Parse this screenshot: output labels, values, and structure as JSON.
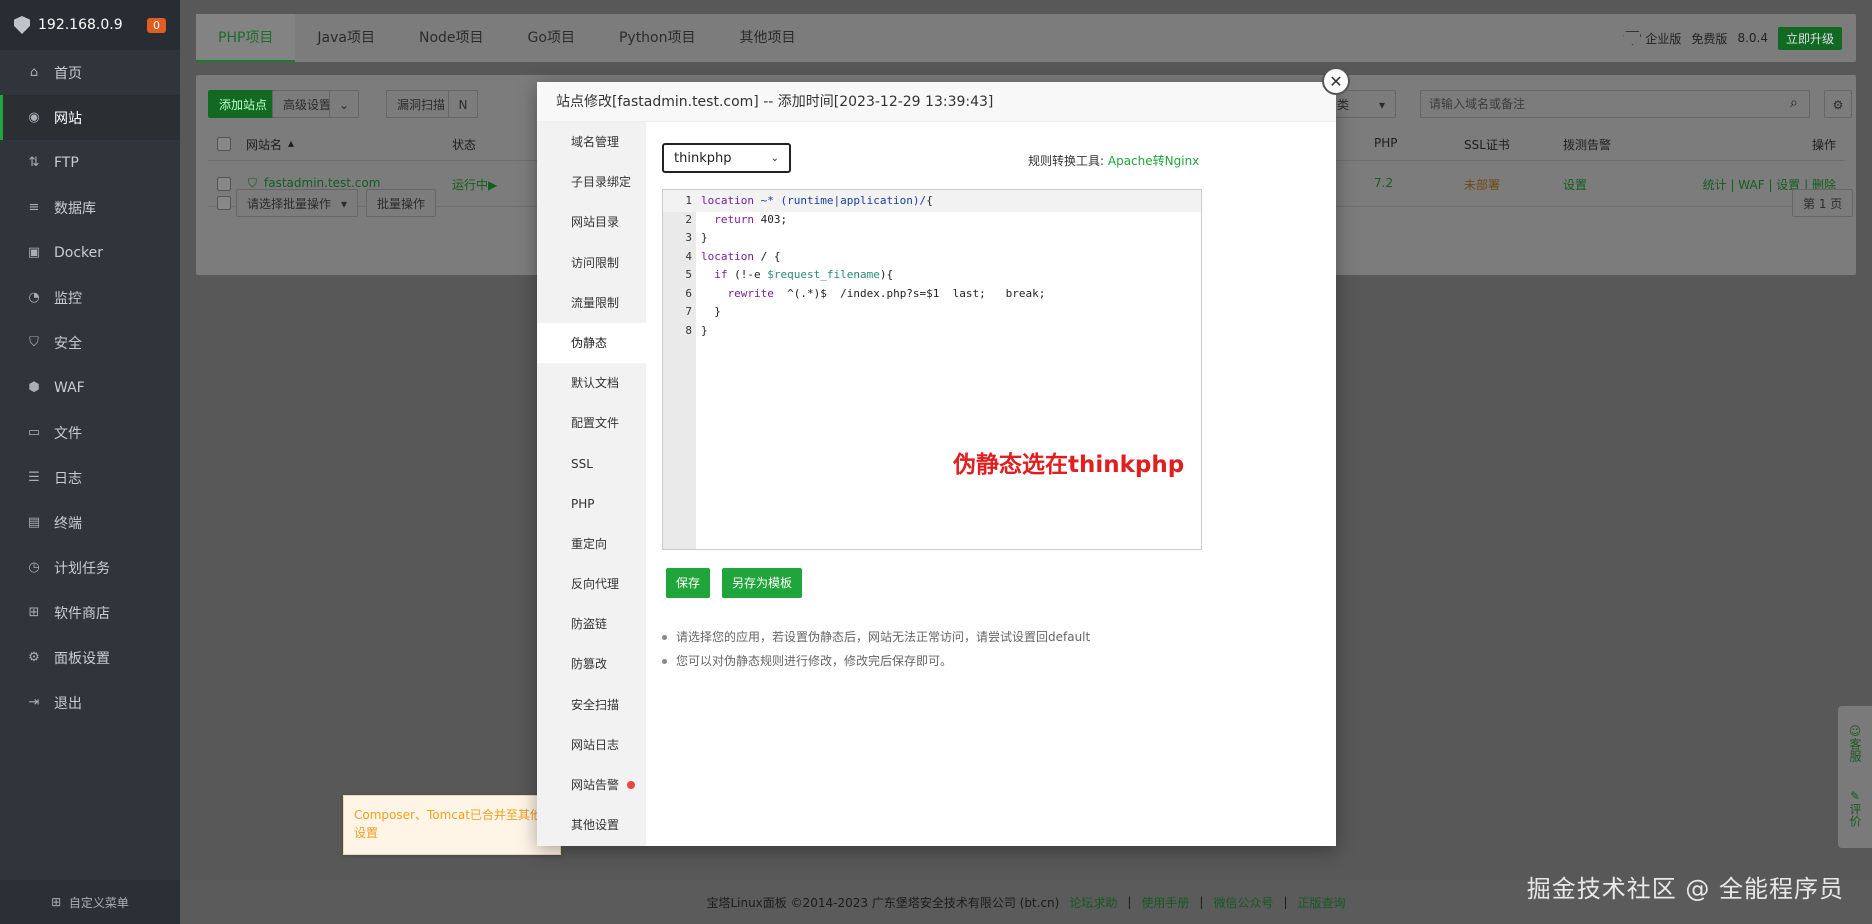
{
  "sidebar": {
    "ip": "192.168.0.9",
    "badge": "0",
    "items": [
      {
        "label": "首页",
        "icon": "home-icon",
        "glyph": "⌂"
      },
      {
        "label": "网站",
        "icon": "globe-icon",
        "glyph": "◉"
      },
      {
        "label": "FTP",
        "icon": "ftp-icon",
        "glyph": "⇅"
      },
      {
        "label": "数据库",
        "icon": "database-icon",
        "glyph": "≡"
      },
      {
        "label": "Docker",
        "icon": "docker-icon",
        "glyph": "▣"
      },
      {
        "label": "监控",
        "icon": "monitor-icon",
        "glyph": "◔"
      },
      {
        "label": "安全",
        "icon": "shield-icon",
        "glyph": "⛉"
      },
      {
        "label": "WAF",
        "icon": "waf-icon",
        "glyph": "⬢"
      },
      {
        "label": "文件",
        "icon": "folder-icon",
        "glyph": "▭"
      },
      {
        "label": "日志",
        "icon": "log-icon",
        "glyph": "☰"
      },
      {
        "label": "终端",
        "icon": "terminal-icon",
        "glyph": "▤"
      },
      {
        "label": "计划任务",
        "icon": "clock-icon",
        "glyph": "◷"
      },
      {
        "label": "软件商店",
        "icon": "apps-icon",
        "glyph": "⊞"
      },
      {
        "label": "面板设置",
        "icon": "gear-icon",
        "glyph": "⚙"
      },
      {
        "label": "退出",
        "icon": "logout-icon",
        "glyph": "⇥"
      }
    ],
    "footer": "自定义菜单"
  },
  "topbar": {
    "tabs": [
      "PHP项目",
      "Java项目",
      "Node项目",
      "Go项目",
      "Python项目",
      "其他项目"
    ],
    "enterprise": "企业版",
    "free": "免费版",
    "version": "8.0.4",
    "upgrade": "立即升级"
  },
  "bg": {
    "add_site": "添加站点",
    "advanced": "高级设置",
    "scan": "漏洞扫描",
    "category": "类",
    "search_placeholder": "请输入域名或备注",
    "headers": {
      "name": "网站名",
      "status": "状态",
      "php": "PHP",
      "ssl": "SSL证书",
      "alert": "拨测告警",
      "ops": "操作"
    },
    "row": {
      "name": "fastadmin.test.com",
      "status": "运行中▶",
      "php": "7.2",
      "ssl": "未部署",
      "alert": "设置",
      "ops": [
        "统计",
        "WAF",
        "设置",
        "删除"
      ]
    },
    "batch_select": "请选择批量操作",
    "batch_btn": "批量操作",
    "page": "第 1 页"
  },
  "modal": {
    "title": "站点修改[fastadmin.test.com] -- 添加时间[2023-12-29 13:39:43]",
    "nav": [
      "域名管理",
      "子目录绑定",
      "网站目录",
      "访问限制",
      "流量限制",
      "伪静态",
      "默认文档",
      "配置文件",
      "SSL",
      "PHP",
      "重定向",
      "反向代理",
      "防盗链",
      "防篡改",
      "安全扫描",
      "网站日志",
      "网站告警",
      "其他设置"
    ],
    "active_nav": "伪静态",
    "select_value": "thinkphp",
    "rule_tool_label": "规则转换工具:",
    "rule_tool_link": "Apache转Nginx",
    "code_lines": [
      "location ~* (runtime|application)/{",
      "  return 403;",
      "}",
      "location / {",
      "  if (!-e $request_filename){",
      "    rewrite  ^(.*)$  /index.php?s=$1  last;   break;",
      "  }",
      "}"
    ],
    "annotation": "伪静态选在thinkphp",
    "save": "保存",
    "save_template": "另存为模板",
    "notes": [
      "请选择您的应用，若设置伪静态后，网站无法正常访问，请尝试设置回default",
      "您可以对伪静态规则进行修改，修改完后保存即可。"
    ]
  },
  "tooltip": "Composer、Tomcat已合并至其他设置",
  "float": {
    "service": "客服",
    "rate": "评价"
  },
  "footer": {
    "copyright": "宝塔Linux面板 ©2014-2023 广东堡塔安全技术有限公司 (bt.cn)",
    "links": [
      "论坛求助",
      "使用手册",
      "微信公众号",
      "正版查询"
    ]
  },
  "watermark": "掘金技术社区 @ 全能程序员"
}
